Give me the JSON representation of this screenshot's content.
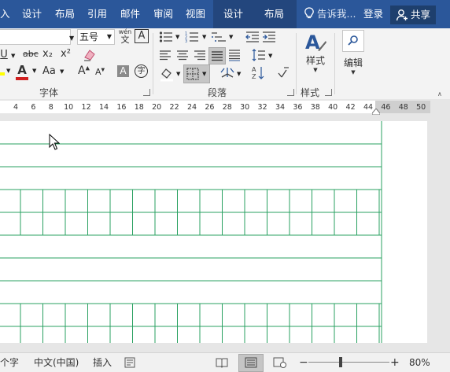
{
  "tabs": [
    {
      "label": "入",
      "active": false
    },
    {
      "label": "设计",
      "active": false
    },
    {
      "label": "布局",
      "active": false
    },
    {
      "label": "引用",
      "active": false
    },
    {
      "label": "邮件",
      "active": false
    },
    {
      "label": "审阅",
      "active": false
    },
    {
      "label": "视图",
      "active": false
    },
    {
      "label": "设计",
      "active": false
    },
    {
      "label": "布局",
      "active": false
    }
  ],
  "tell_me": "告诉我...",
  "login": "登录",
  "share": "共享",
  "font": {
    "size_value": "五号",
    "phonetic_top": "wén",
    "phonetic_bottom": "文",
    "char_border": "A",
    "underline": "U",
    "strike": "abc",
    "subscript": "x₂",
    "superscript": "x²",
    "font_color": "A",
    "change_case": "Aa",
    "grow_font": "A",
    "shrink_font": "A",
    "char_shading": "A",
    "enclose": "字",
    "group_label": "字体"
  },
  "paragraph": {
    "group_label": "段落"
  },
  "styles": {
    "button_label": "样式",
    "group_label": "样式"
  },
  "editing": {
    "button_label": "编辑"
  },
  "ruler": {
    "ticks": [
      "4",
      "6",
      "8",
      "10",
      "12",
      "14",
      "16",
      "18",
      "20",
      "22",
      "24",
      "26",
      "28",
      "30",
      "32",
      "34",
      "36",
      "38",
      "40",
      "42",
      "44",
      "46",
      "48",
      "50"
    ]
  },
  "status": {
    "word_count": "个字",
    "language": "中文(中国)",
    "insert_mode": "插入",
    "zoom": "80%",
    "zoom_fraction": 0.4
  },
  "colors": {
    "accent": "#2b579a",
    "grid": "#28a060",
    "font_color_bar": "#d02020",
    "highlight_bar": "#ffff00"
  }
}
